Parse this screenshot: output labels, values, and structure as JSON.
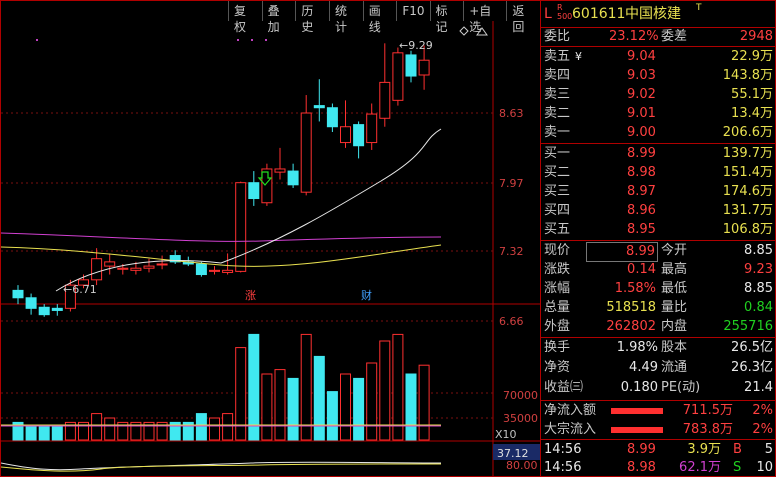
{
  "toolbar": [
    "复权",
    "叠加",
    "历史",
    "统计",
    "画线",
    "F10",
    "标记",
    "+自选",
    "返回"
  ],
  "chart": {
    "price_labels": [
      "8.63",
      "7.97",
      "7.32",
      "6.66"
    ],
    "high_label": "9.29",
    "low_label": "6.71",
    "marker_zhang": "涨",
    "marker_cai": "财",
    "vol_labels": [
      "70000",
      "35000"
    ],
    "vol_unit": "X10",
    "ind_label": "80.00",
    "ind_value": "37.12"
  },
  "header": {
    "prefix": "L",
    "sub": "R\n500",
    "code": "601611",
    "name": "中国核建",
    "flag": "T"
  },
  "weibi": {
    "label": "委比",
    "value": "23.12%",
    "label2": "委差",
    "value2": "2948"
  },
  "asks": [
    {
      "label": "卖五",
      "mark": "¥",
      "price": "9.04",
      "vol": "22.9万"
    },
    {
      "label": "卖四",
      "mark": "",
      "price": "9.03",
      "vol": "143.8万"
    },
    {
      "label": "卖三",
      "mark": "",
      "price": "9.02",
      "vol": "55.1万"
    },
    {
      "label": "卖二",
      "mark": "",
      "price": "9.01",
      "vol": "13.4万"
    },
    {
      "label": "卖一",
      "mark": "",
      "price": "9.00",
      "vol": "206.6万"
    }
  ],
  "bids": [
    {
      "label": "买一",
      "price": "8.99",
      "vol": "139.7万"
    },
    {
      "label": "买二",
      "price": "8.98",
      "vol": "151.4万"
    },
    {
      "label": "买三",
      "price": "8.97",
      "vol": "174.6万"
    },
    {
      "label": "买四",
      "price": "8.96",
      "vol": "131.7万"
    },
    {
      "label": "买五",
      "price": "8.95",
      "vol": "106.8万"
    }
  ],
  "quote": [
    {
      "l1": "现价",
      "v1": "8.99",
      "c1": "red",
      "l2": "今开",
      "v2": "8.85",
      "c2": "wht"
    },
    {
      "l1": "涨跌",
      "v1": "0.14",
      "c1": "red",
      "l2": "最高",
      "v2": "9.23",
      "c2": "red"
    },
    {
      "l1": "涨幅",
      "v1": "1.58%",
      "c1": "red",
      "l2": "最低",
      "v2": "8.85",
      "c2": "wht"
    },
    {
      "l1": "总量",
      "v1": "518518",
      "c1": "yel",
      "l2": "量比",
      "v2": "0.84",
      "c2": "grn"
    },
    {
      "l1": "外盘",
      "v1": "262802",
      "c1": "red",
      "l2": "内盘",
      "v2": "255716",
      "c2": "grn"
    }
  ],
  "info": [
    {
      "l1": "换手",
      "v1": "1.98%",
      "l2": "股本",
      "v2": "26.5亿"
    },
    {
      "l1": "净资",
      "v1": "4.49",
      "l2": "流通",
      "v2": "26.3亿"
    },
    {
      "l1": "收益㈢",
      "v1": "0.180",
      "l2": "PE(动)",
      "v2": "21.4"
    }
  ],
  "flows": [
    {
      "label": "净流入额",
      "value": "711.5万",
      "pct": "2%"
    },
    {
      "label": "大宗流入",
      "value": "783.8万",
      "pct": "2%"
    }
  ],
  "ticks": [
    {
      "time": "14:56",
      "price": "8.99",
      "vol": "3.9万",
      "side": "B",
      "side_color": "red",
      "n": "5"
    },
    {
      "time": "14:56",
      "price": "8.98",
      "vol": "62.1万",
      "side": "S",
      "side_color": "grn",
      "n": "10"
    }
  ],
  "colors": {
    "up": "#ff3030",
    "down": "#40e8f0",
    "ma5": "#e8e8e8",
    "ma10": "#e8e050",
    "ma20": "#d040d0",
    "border": "#b00000"
  }
}
